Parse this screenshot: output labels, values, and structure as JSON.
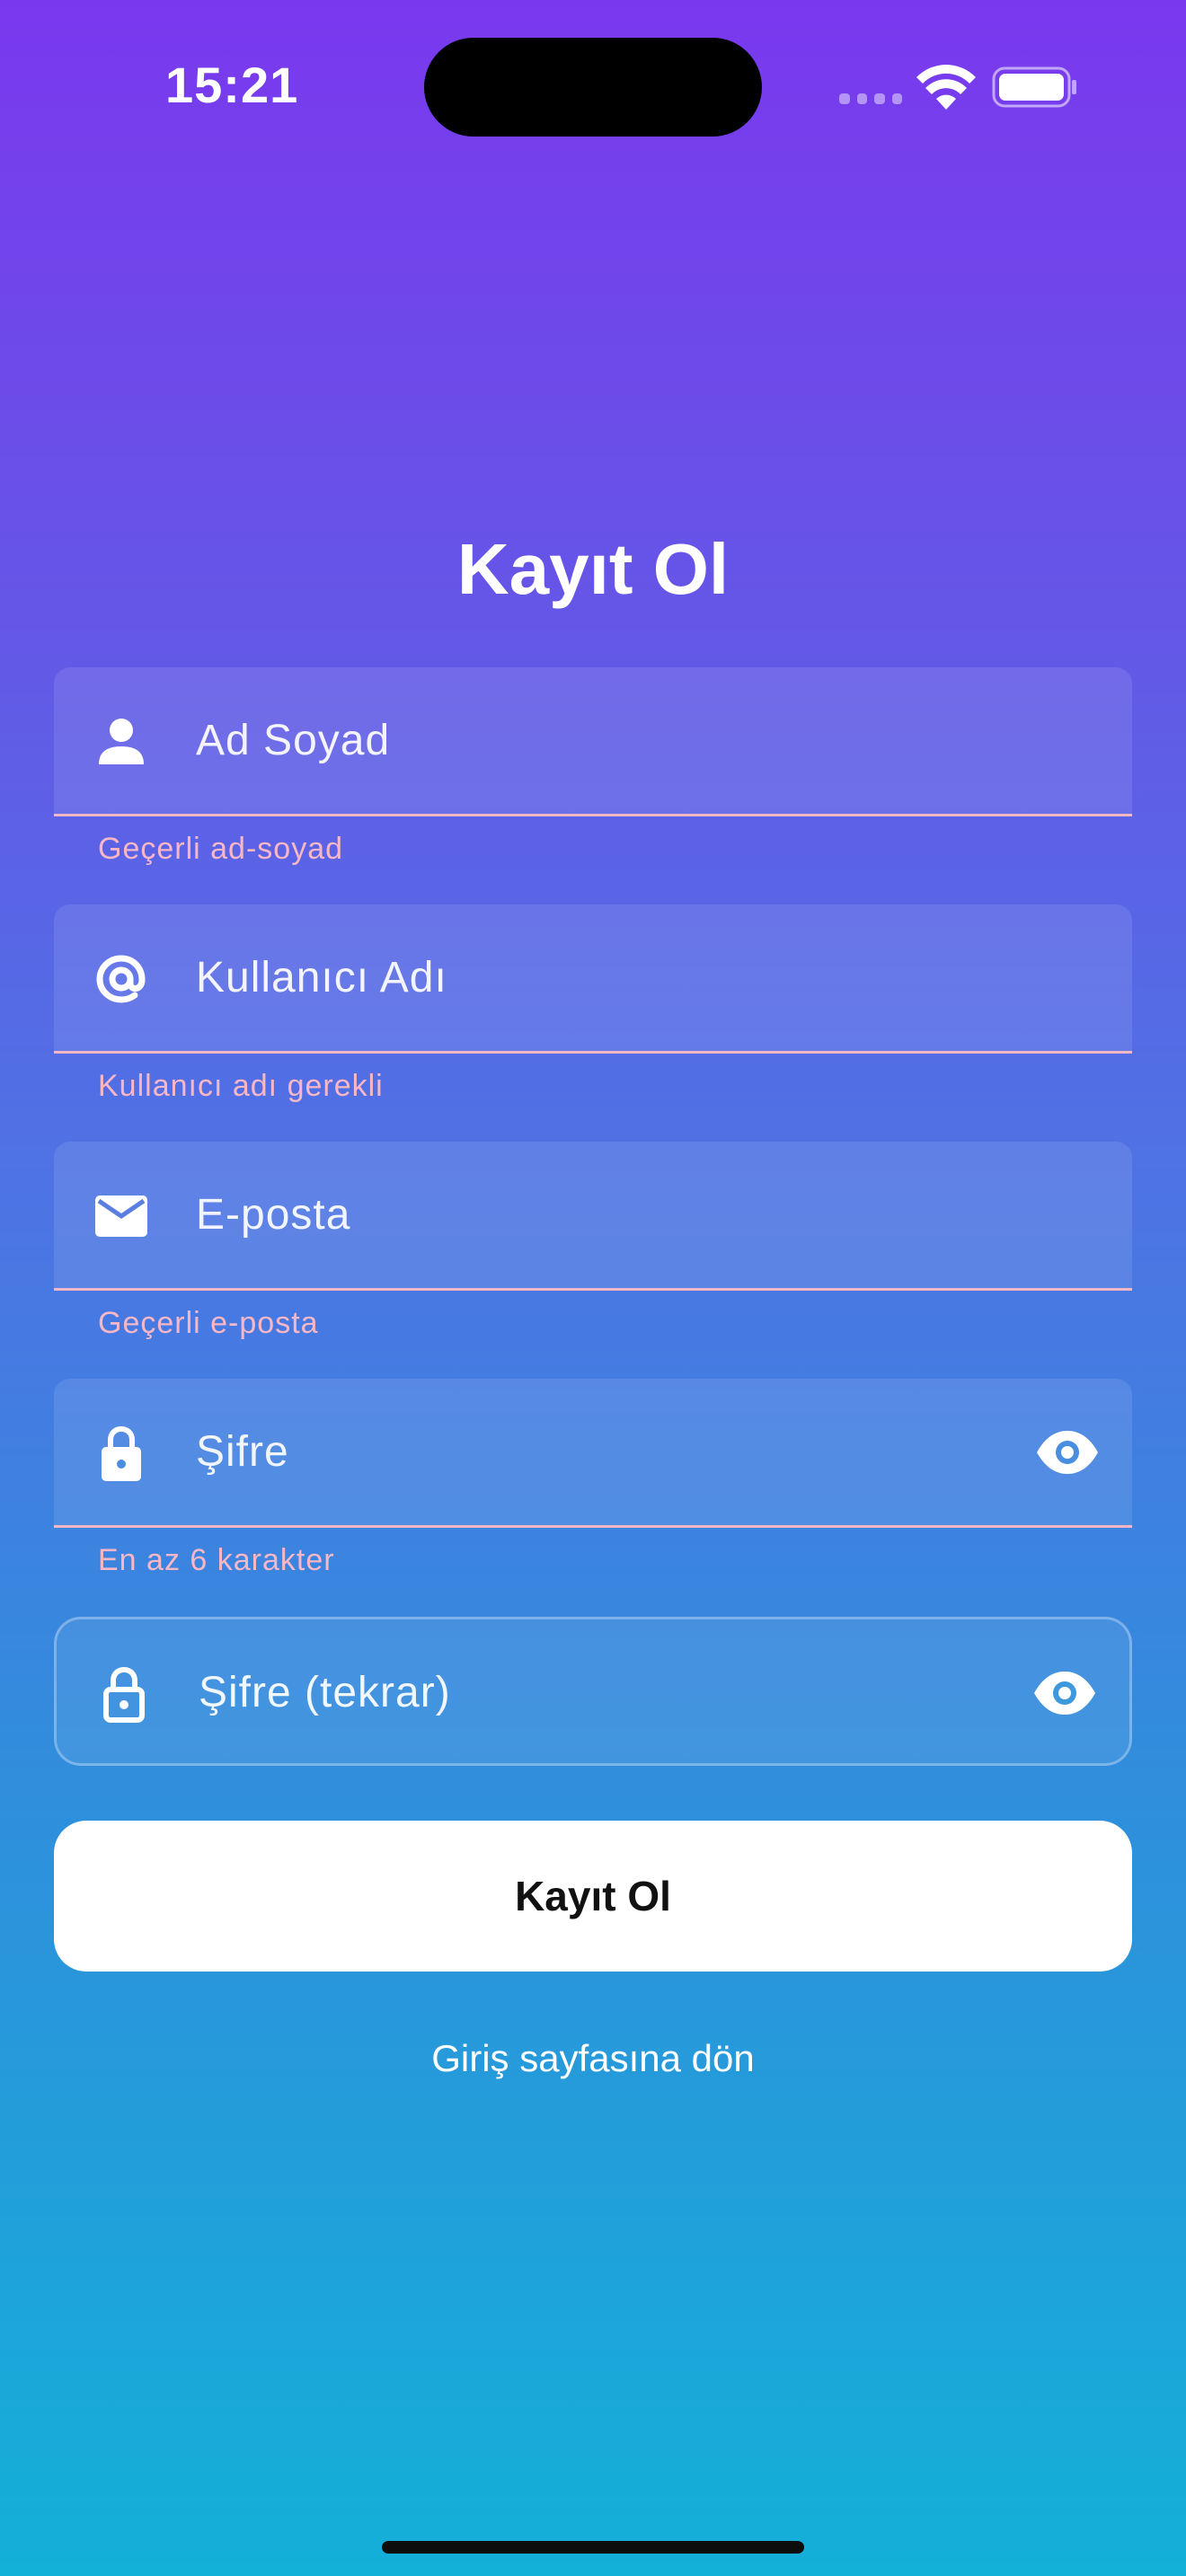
{
  "status_bar": {
    "time": "15:21"
  },
  "form": {
    "title": "Kayıt Ol",
    "fields": [
      {
        "placeholder": "Ad Soyad",
        "icon": "person-icon",
        "error": "Geçerli ad-soyad"
      },
      {
        "placeholder": "Kullanıcı Adı",
        "icon": "at-sign-icon",
        "error": "Kullanıcı adı gerekli"
      },
      {
        "placeholder": "E-posta",
        "icon": "mail-icon",
        "error": "Geçerli e-posta"
      },
      {
        "placeholder": "Şifre",
        "icon": "lock-icon",
        "error": "En az 6 karakter",
        "trailing_icon": "eye-icon"
      },
      {
        "placeholder": "Şifre (tekrar)",
        "icon": "lock-outline-icon",
        "trailing_icon": "eye-icon"
      }
    ],
    "submit_label": "Kayıt Ol",
    "back_link_label": "Giriş sayfasına dön"
  },
  "colors": {
    "gradient_top": "#7a38ee",
    "gradient_bottom": "#13b0d8",
    "error_text": "#f7b7c6",
    "button_bg": "#ffffff"
  }
}
